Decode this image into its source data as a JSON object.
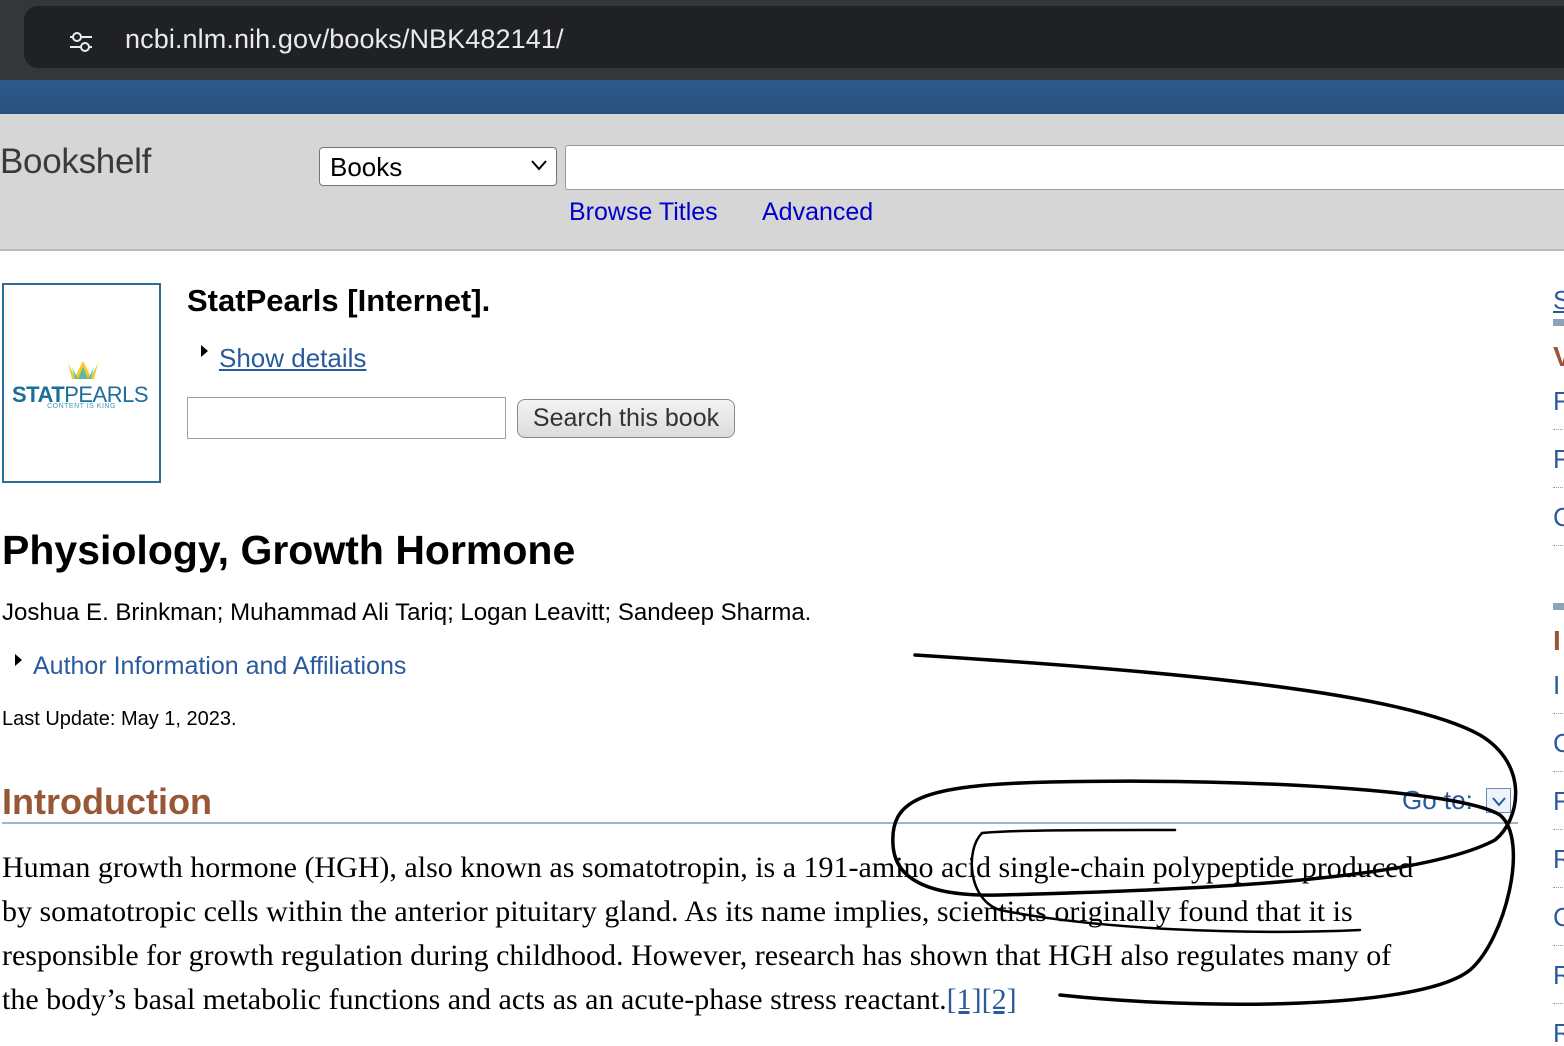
{
  "browser": {
    "url": "ncbi.nlm.nih.gov/books/NBK482141/"
  },
  "header": {
    "title": "Bookshelf",
    "db_select_value": "Books",
    "search_value": "",
    "links": [
      "Browse Titles",
      "Advanced"
    ]
  },
  "book": {
    "cover_brand_stat": "STAT",
    "cover_brand_pearls": "PEARLS",
    "cover_tagline": "CONTENT IS KING",
    "title": "StatPearls [Internet].",
    "show_details": "Show details",
    "search_placeholder": "",
    "search_button": "Search this book"
  },
  "chapter": {
    "title": "Physiology, Growth Hormone",
    "authors": "Joshua E. Brinkman; Muhammad Ali Tariq; Logan Leavitt; Sandeep Sharma.",
    "author_info": "Author Information and Affiliations",
    "last_update": "Last Update: May 1, 2023."
  },
  "introduction": {
    "heading": "Introduction",
    "goto": "Go to:",
    "lines": [
      "Human growth hormone (HGH), also known as somatotropin, is a 191-amino acid single-chain polypeptide produced",
      "by somatotropic cells within the anterior pituitary gland. As its name implies, scientists originally found that it is",
      "responsible for growth regulation during childhood. However, research has shown that HGH also regulates many of",
      "the body’s basal metabolic functions and acts as an acute-phase stress reactant."
    ],
    "refs": "[1][2]"
  },
  "sidebar": {
    "letters": [
      "S",
      "V",
      "F",
      "F",
      "C",
      "I",
      "I",
      "C",
      "F",
      "R",
      "C",
      "R",
      "R"
    ]
  },
  "colors": {
    "link_blue": "#2a5a9c",
    "heading_brown": "#985735",
    "ncbi_blue": "#2f5a8c",
    "header_gray": "#d6d6d6"
  },
  "icons": [
    "tune-icon",
    "chevron-down-icon",
    "statpearls-crown-icon",
    "disclosure-triangle-icon",
    "goto-chevron-icon"
  ]
}
